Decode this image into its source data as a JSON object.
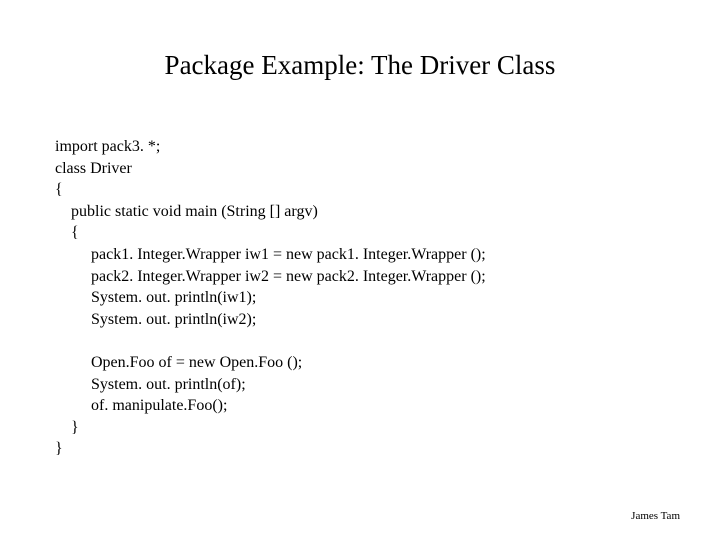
{
  "title": "Package Example: The Driver Class",
  "code": {
    "line1": "import pack3. *;",
    "line2": "class Driver",
    "line3": "{",
    "line4": "    public static void main (String [] argv)",
    "line5": "    {",
    "line6": "         pack1. Integer.Wrapper iw1 = new pack1. Integer.Wrapper ();",
    "line7": "         pack2. Integer.Wrapper iw2 = new pack2. Integer.Wrapper ();",
    "line8": "         System. out. println(iw1);",
    "line9": "         System. out. println(iw2);",
    "line10": "",
    "line11": "         Open.Foo of = new Open.Foo ();",
    "line12": "         System. out. println(of);",
    "line13": "         of. manipulate.Foo();",
    "line14": "    }",
    "line15": "}"
  },
  "footer": "James Tam"
}
